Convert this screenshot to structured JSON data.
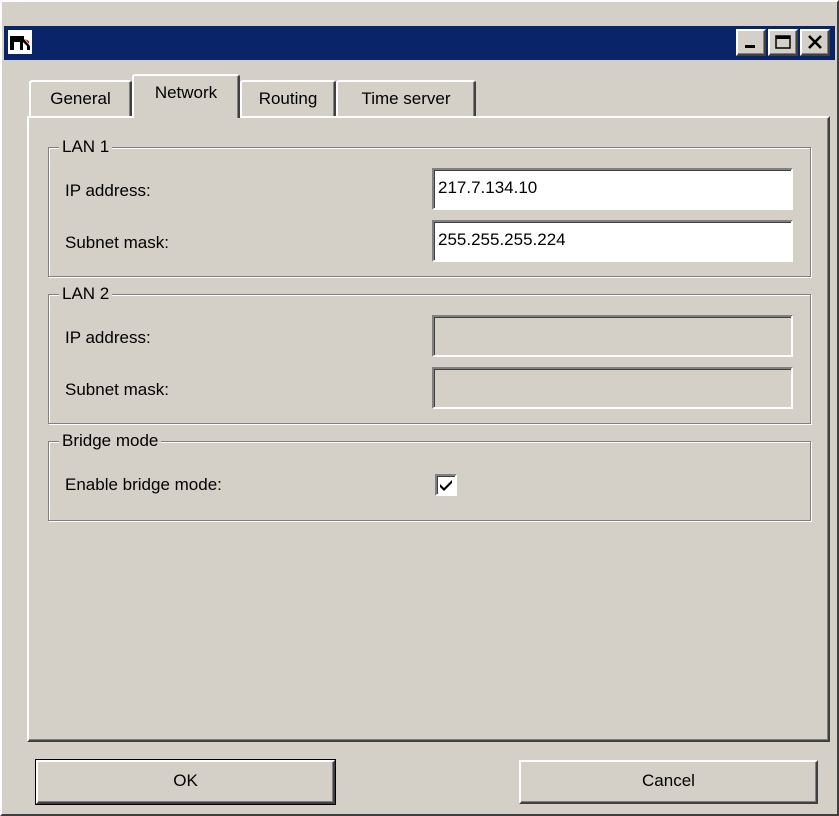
{
  "window": {
    "icon": "app-icon",
    "controls": {
      "minimize": "minimize-icon",
      "maximize": "maximize-icon",
      "close": "close-icon"
    }
  },
  "tabs": [
    {
      "label": "General",
      "active": false
    },
    {
      "label": "Network",
      "active": true
    },
    {
      "label": "Routing",
      "active": false
    },
    {
      "label": "Time server",
      "active": false
    }
  ],
  "lan1": {
    "legend": "LAN 1",
    "ip_label": "IP address:",
    "ip_value": "217.7.134.10",
    "mask_label": "Subnet mask:",
    "mask_value": "255.255.255.224"
  },
  "lan2": {
    "legend": "LAN 2",
    "ip_label": "IP address:",
    "ip_value": "",
    "mask_label": "Subnet mask:",
    "mask_value": ""
  },
  "bridge": {
    "legend": "Bridge mode",
    "enable_label": "Enable bridge mode:",
    "enabled": true
  },
  "buttons": {
    "ok": "OK",
    "cancel": "Cancel"
  },
  "colors": {
    "titlebar": "#0a246a",
    "face": "#d4d0c8"
  }
}
